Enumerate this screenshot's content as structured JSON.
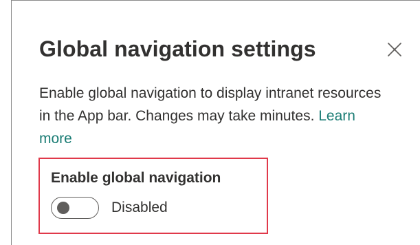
{
  "panel": {
    "title": "Global navigation settings",
    "close_icon": "close-icon",
    "description_text": "Enable global navigation to display intranet resources in the App bar. Changes may take minutes. ",
    "learn_more_label": "Learn more"
  },
  "setting": {
    "label": "Enable global navigation",
    "toggle_state": "off",
    "status_text": "Disabled"
  },
  "colors": {
    "accent_link": "#1a7c74",
    "highlight_border": "#e0394a",
    "text_primary": "#323130",
    "toggle_off": "#605e5c"
  }
}
